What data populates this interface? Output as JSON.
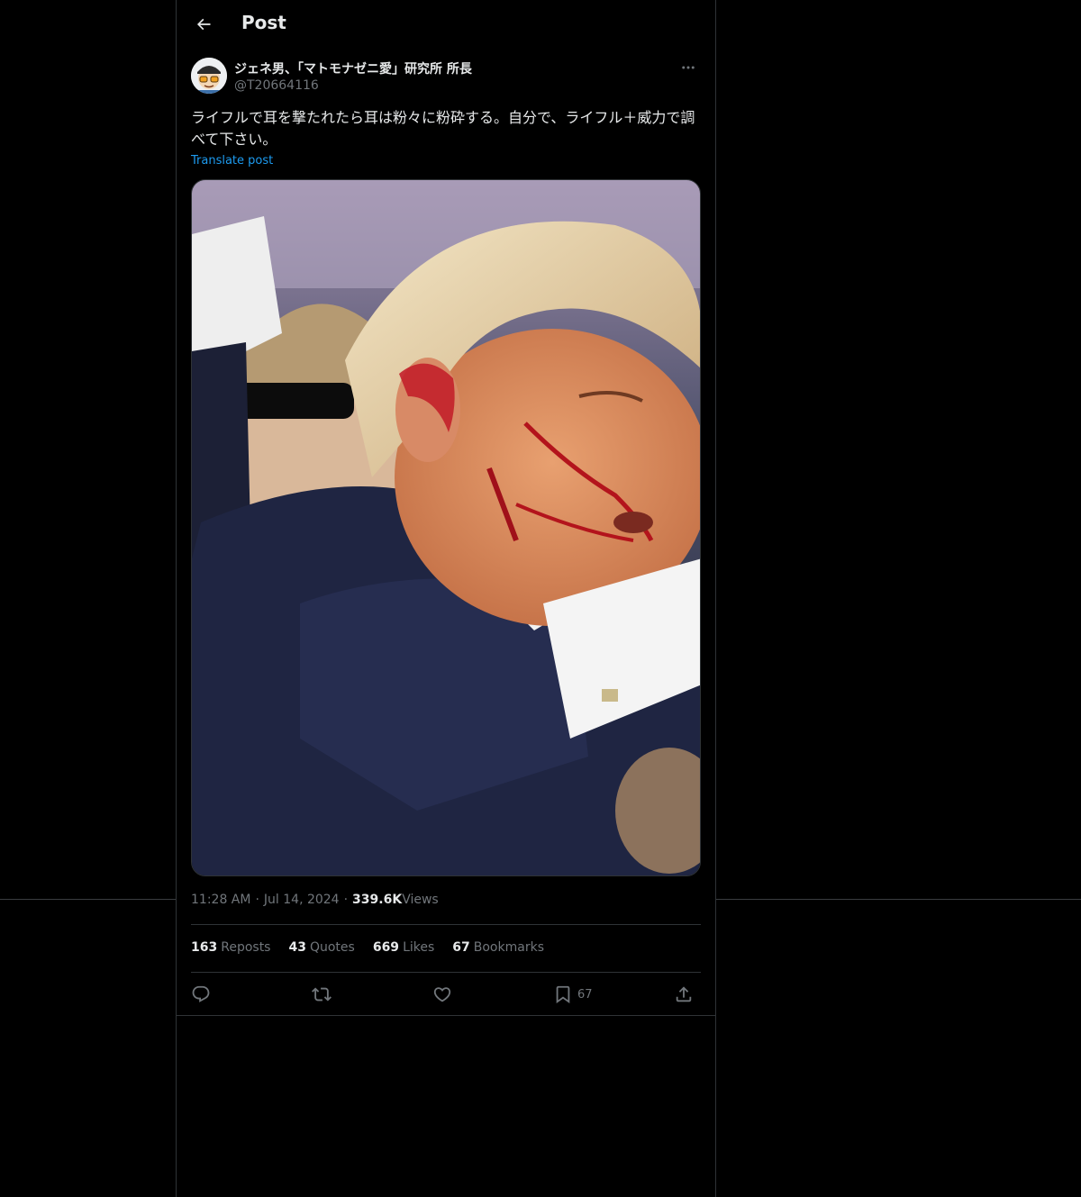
{
  "header": {
    "title": "Post",
    "back_icon": "arrow-left-icon"
  },
  "author": {
    "display_name": "ジェネ男、「マトモナゼニ愛」研究所 所長",
    "handle": "@T20664116"
  },
  "post": {
    "text": "ライフルで耳を撃たれたら耳は粉々に粉砕する。自分で、ライフル＋威力で調べて下さい。",
    "translate_label": "Translate post"
  },
  "meta": {
    "time": "11:28 AM",
    "date": "Jul 14, 2024",
    "views_count": "339.6K",
    "views_label": "Views"
  },
  "stats": {
    "reposts_count": "163",
    "reposts_label": "Reposts",
    "quotes_count": "43",
    "quotes_label": "Quotes",
    "likes_count": "669",
    "likes_label": "Likes",
    "bookmarks_count": "67",
    "bookmarks_label": "Bookmarks"
  },
  "actions": {
    "reply_icon": "reply-icon",
    "repost_icon": "repost-icon",
    "like_icon": "heart-icon",
    "bookmark_icon": "bookmark-icon",
    "bookmark_count": "67",
    "share_icon": "share-icon"
  },
  "colors": {
    "background": "#000000",
    "text": "#e7e9ea",
    "muted": "#71767b",
    "link": "#1d9bf0",
    "border": "#2f3336"
  }
}
